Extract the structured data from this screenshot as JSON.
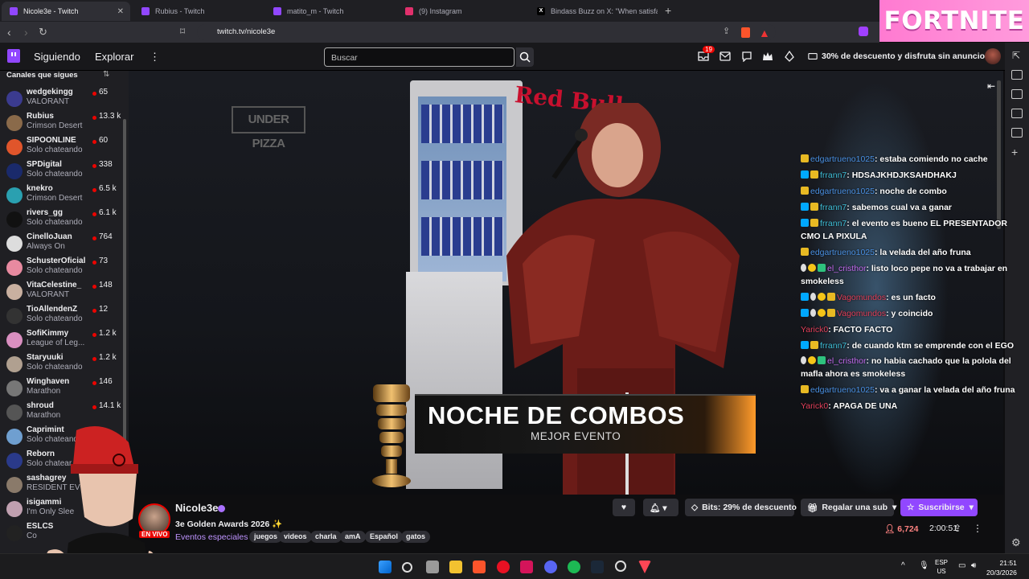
{
  "browser": {
    "tabs": [
      {
        "title": "Nicole3e - Twitch",
        "color": "#9147ff",
        "active": true
      },
      {
        "title": "Rubius - Twitch",
        "color": "#9147ff"
      },
      {
        "title": "matito_m - Twitch",
        "color": "#9147ff"
      },
      {
        "title": "(9) Instagram",
        "color": "#e1306c"
      },
      {
        "title": "Bindass Buzz on X: \"When satisfactio",
        "color": "#000000"
      }
    ],
    "new_tab": "+",
    "url": "twitch.tv/nicole3e",
    "ad_text": "FORTNITE"
  },
  "topbar": {
    "following": "Siguiendo",
    "browse": "Explorar",
    "more": "⋮",
    "search_placeholder": "Buscar",
    "notifications_count": "19",
    "promo": "30% de descuento y disfruta sin anuncios"
  },
  "sidebar": {
    "header": "Canales que sigues",
    "channels": [
      {
        "name": "wedgekingg",
        "game": "VALORANT",
        "viewers": "65",
        "color": "#3b3b8f"
      },
      {
        "name": "Rubius",
        "game": "Crimson Desert",
        "viewers": "13.3 k",
        "color": "#8a6a4a"
      },
      {
        "name": "SIPOONLINE",
        "game": "Solo chateando",
        "viewers": "60",
        "color": "#e0552b"
      },
      {
        "name": "SPDigital",
        "game": "Solo chateando",
        "viewers": "338",
        "color": "#1a2a6b"
      },
      {
        "name": "knekro",
        "game": "Crimson Desert",
        "viewers": "6.5 k",
        "color": "#2aa0b0"
      },
      {
        "name": "rivers_gg",
        "game": "Solo chateando",
        "viewers": "6.1 k",
        "color": "#111111"
      },
      {
        "name": "CinelloJuan",
        "game": "Always On",
        "viewers": "764",
        "color": "#dddddd"
      },
      {
        "name": "SchusterOficial",
        "game": "Solo chateando",
        "viewers": "73",
        "color": "#e88aa0"
      },
      {
        "name": "VitaCelestine_",
        "game": "VALORANT",
        "viewers": "148",
        "color": "#c9b0a0"
      },
      {
        "name": "TioAllendenZ",
        "game": "Solo chateando",
        "viewers": "12",
        "color": "#333333"
      },
      {
        "name": "SofiKimmy",
        "game": "League of Leg...",
        "viewers": "1.2 k",
        "color": "#d98fc0"
      },
      {
        "name": "Staryuuki",
        "game": "Solo chateando",
        "viewers": "1.2 k",
        "color": "#b0a090"
      },
      {
        "name": "Winghaven",
        "game": "Marathon",
        "viewers": "146",
        "color": "#777777"
      },
      {
        "name": "shroud",
        "game": "Marathon",
        "viewers": "14.1 k",
        "color": "#555555"
      },
      {
        "name": "Caprimint",
        "game": "Solo chateando",
        "viewers": "",
        "color": "#6f9fd0"
      },
      {
        "name": "Reborn",
        "game": "Solo chatear",
        "viewers": "",
        "color": "#2a3a8a"
      },
      {
        "name": "sashagrey",
        "game": "RESIDENT EV",
        "viewers": "",
        "color": "#8a7a6a"
      },
      {
        "name": "isigammi",
        "game": "I'm Only Slee",
        "viewers": "",
        "color": "#c0a0b0"
      },
      {
        "name": "ESLCS",
        "game": "Co",
        "viewers": "",
        "color": "#222222"
      }
    ]
  },
  "video": {
    "lower_third_title": "NOCHE DE COMBOS",
    "lower_third_sub": "MEJOR EVENTO",
    "watermark": "UNDER PIZZA",
    "brand": "Red Bull"
  },
  "chat": [
    {
      "user": "edgartrueno1025",
      "color": "#4a90e2",
      "badges": [
        "gold"
      ],
      "text": ": estaba comiendo no cache"
    },
    {
      "user": "frrann7",
      "color": "#3fbfd8",
      "badges": [
        "prime",
        "gold"
      ],
      "text": ": HDSAJKHDJKSAHDHAKJ"
    },
    {
      "user": "edgartrueno1025",
      "color": "#4a90e2",
      "badges": [
        "gold"
      ],
      "text": ": noche de combo"
    },
    {
      "user": "frrann7",
      "color": "#3fbfd8",
      "badges": [
        "prime",
        "gold"
      ],
      "text": ":  sabemos cual va a ganar"
    },
    {
      "user": "frrann7",
      "color": "#3fbfd8",
      "badges": [
        "prime",
        "gold"
      ],
      "text": ": el evento es bueno EL PRESENTADOR CMO LA PIXULA"
    },
    {
      "user": "edgartrueno1025",
      "color": "#4a90e2",
      "badges": [
        "gold"
      ],
      "text": ": la velada del año fruna"
    },
    {
      "user": "el_cristhor",
      "color": "#c56cf0",
      "badges": [
        "person",
        "num",
        "green"
      ],
      "text": ": listo loco pepe no va a trabajar en smokeless"
    },
    {
      "user": "Vagomundos",
      "color": "#e0405a",
      "badges": [
        "prime",
        "person",
        "num",
        "gold"
      ],
      "text": ": es un facto"
    },
    {
      "user": "Vagomundos",
      "color": "#e0405a",
      "badges": [
        "prime",
        "person",
        "num",
        "gold"
      ],
      "text": ": y coincido"
    },
    {
      "user": "Yarick0",
      "color": "#e0405a",
      "badges": [],
      "text": ": FACTO FACTO"
    },
    {
      "user": "frrann7",
      "color": "#3fbfd8",
      "badges": [
        "prime",
        "gold"
      ],
      "text": ": de cuando ktm se emprende con el EGO"
    },
    {
      "user": "el_cristhor",
      "color": "#c56cf0",
      "badges": [
        "person",
        "num",
        "green"
      ],
      "text": ": no habia cachado que la polola del mafla ahora es smokeless"
    },
    {
      "user": "edgartrueno1025",
      "color": "#4a90e2",
      "badges": [
        "gold"
      ],
      "text": ": va a ganar la velada del año fruna"
    },
    {
      "user": "Yarick0",
      "color": "#e0405a",
      "badges": [],
      "text": ": APAGA DE UNA"
    }
  ],
  "stream": {
    "name": "Nicole3e",
    "title": "3e Golden Awards 2026 ✨",
    "category": "Eventos especiales",
    "live_label": "EN VIVO",
    "tags": [
      "juegos",
      "videos",
      "charla",
      "amA",
      "Español",
      "gatos"
    ],
    "bits_label": "Bits: 29% de descuento",
    "gift_label": "Regalar una sub",
    "subscribe_label": "Suscribirse",
    "viewers": "6,724",
    "uptime": "2:00:51"
  },
  "taskbar": {
    "lang_top": "ESP",
    "lang_bottom": "US",
    "time": "21:51",
    "date": "20/3/2026"
  }
}
